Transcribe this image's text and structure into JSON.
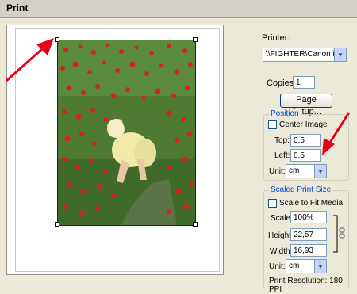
{
  "window": {
    "title": "Print"
  },
  "printer": {
    "label": "Printer:",
    "value": "\\\\FIGHTER\\Canon iP..."
  },
  "copies": {
    "label": "Copies:",
    "value": "1"
  },
  "page_setup": {
    "label": "Page Setup..."
  },
  "position": {
    "group_title": "Position",
    "center_image_label": "Center Image",
    "top_label": "Top:",
    "top_value": "0,5",
    "left_label": "Left:",
    "left_value": "0,5",
    "unit_label": "Unit:",
    "unit_value": "cm"
  },
  "scaled": {
    "group_title": "Scaled Print Size",
    "scale_to_fit_label": "Scale to Fit Media",
    "scale_label": "Scale:",
    "scale_value": "100%",
    "height_label": "Height:",
    "height_value": "22,57",
    "width_label": "Width:",
    "width_value": "16,93",
    "unit_label": "Unit:",
    "unit_value": "cm",
    "resolution": "Print Resolution: 180 PPI"
  },
  "colors": {
    "arrow": "#e8001a",
    "group_title": "#0046d5"
  }
}
